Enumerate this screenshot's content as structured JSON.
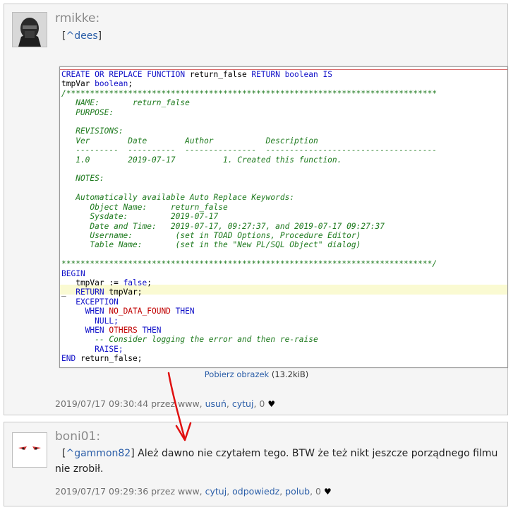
{
  "posts": [
    {
      "author": "rmikke:",
      "reply_prefix": "[",
      "reply_link": "^dees",
      "reply_suffix": "]",
      "image_link": "Pobierz obrazek",
      "image_size": "(13.2kiB)",
      "meta_text": "2019/07/17 09:30:44 przez www,",
      "actions": [
        "usuń",
        "cytuj"
      ],
      "votes": "0"
    },
    {
      "author": "boni01:",
      "reply_prefix": "[",
      "reply_link": "^gammon82",
      "reply_suffix": "]",
      "message": "Ależ dawno nie czytałem tego. BTW że też nikt jeszcze porządnego filmu nie zrobił.",
      "meta_text": "2019/07/17 09:29:36 przez www,",
      "actions": [
        "cytuj",
        "odpowiedz",
        "polub"
      ],
      "votes": "0"
    }
  ],
  "code": {
    "l1_kw": "CREATE OR REPLACE FUNCTION",
    "l1_name": " return_false ",
    "l1_kw2": "RETURN boolean IS",
    "l2_var": "tmpVar ",
    "l2_type": "boolean",
    "l2_end": ";",
    "comment_block": "/******************************************************************************\n   NAME:       return_false\n   PURPOSE:\n\n   REVISIONS:\n   Ver        Date        Author           Description\n   ---------  ----------  ---------------  ------------------------------------\n   1.0        2019-07-17          1. Created this function.\n\n   NOTES:\n\n   Automatically available Auto Replace Keywords:\n      Object Name:     return_false\n      Sysdate:         2019-07-17\n      Date and Time:   2019-07-17, 09:27:37, and 2019-07-17 09:27:37\n      Username:         (set in TOAD Options, Procedure Editor)\n      Table Name:       (set in the \"New PL/SQL Object\" dialog)\n\n******************************************************************************/",
    "begin": "BEGIN",
    "assign": "   tmpVar := ",
    "false_kw": "false",
    "assign_end": ";",
    "ret_prefix": "_  ",
    "ret_kw": "RETURN",
    "ret_rest": " tmpVar;",
    "exception": "   EXCEPTION",
    "when": "     WHEN ",
    "ndf": "NO_DATA_FOUND",
    "then": " THEN",
    "null": "       NULL;",
    "others": "OTHERS",
    "consider": "       -- Consider logging the error and then re-raise",
    "raise": "       RAISE;",
    "end_kw": "END",
    "end_rest": " return_false;"
  }
}
